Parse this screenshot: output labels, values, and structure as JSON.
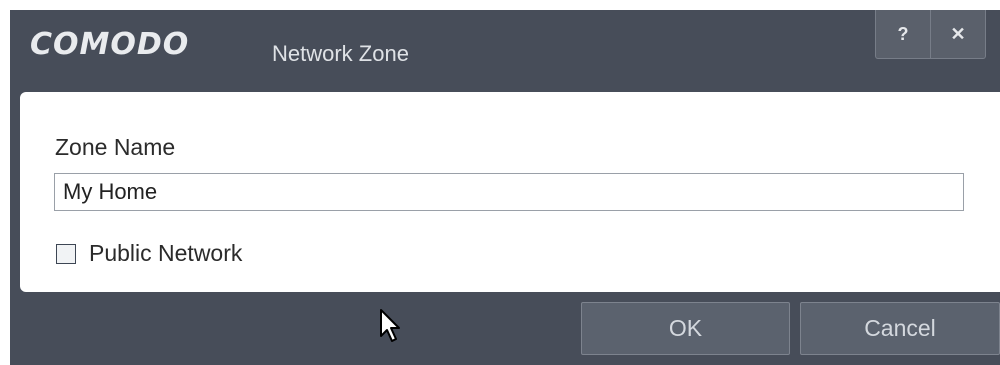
{
  "titlebar": {
    "logo": "COMODO",
    "title": "Network Zone",
    "help_label": "?",
    "close_label": "✕"
  },
  "form": {
    "zone_name_label": "Zone Name",
    "zone_name_value": "My Home",
    "public_network_label": "Public Network",
    "public_network_checked": false
  },
  "buttons": {
    "ok_label": "OK",
    "cancel_label": "Cancel"
  },
  "icons": {
    "cursor": "arrow-cursor-icon"
  }
}
